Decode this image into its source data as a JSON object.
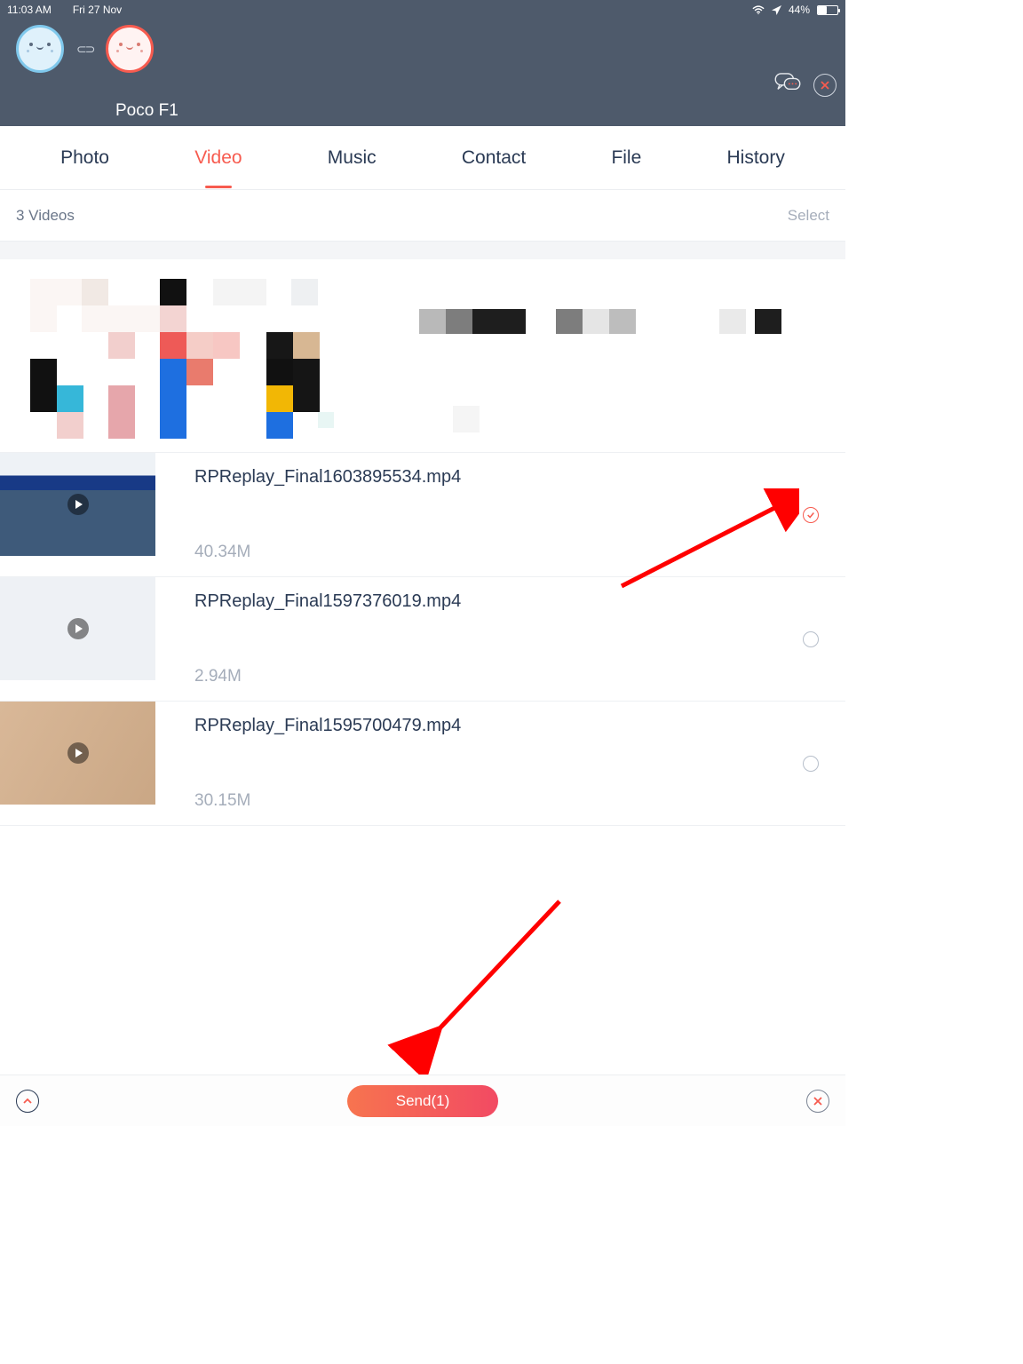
{
  "statusbar": {
    "time": "11:03 AM",
    "date": "Fri 27 Nov",
    "battery_pct": "44%",
    "battery_fill_pct": 44
  },
  "header": {
    "device_name": "Poco F1"
  },
  "tabs": [
    {
      "label": "Photo",
      "active": false
    },
    {
      "label": "Video",
      "active": true
    },
    {
      "label": "Music",
      "active": false
    },
    {
      "label": "Contact",
      "active": false
    },
    {
      "label": "File",
      "active": false
    },
    {
      "label": "History",
      "active": false
    }
  ],
  "countbar": {
    "count_label": "3 Videos",
    "select_label": "Select"
  },
  "files": [
    {
      "name": "RPReplay_Final1603895534.mp4",
      "size": "40.34M",
      "selected": true
    },
    {
      "name": "RPReplay_Final1597376019.mp4",
      "size": "2.94M",
      "selected": false
    },
    {
      "name": "RPReplay_Final1595700479.mp4",
      "size": "30.15M",
      "selected": false
    }
  ],
  "footer": {
    "send_label": "Send(1)"
  },
  "colors": {
    "accent": "#f75b4f",
    "header_bg": "#4e5a6b",
    "text": "#2a3a54",
    "muted": "#a5adba"
  }
}
